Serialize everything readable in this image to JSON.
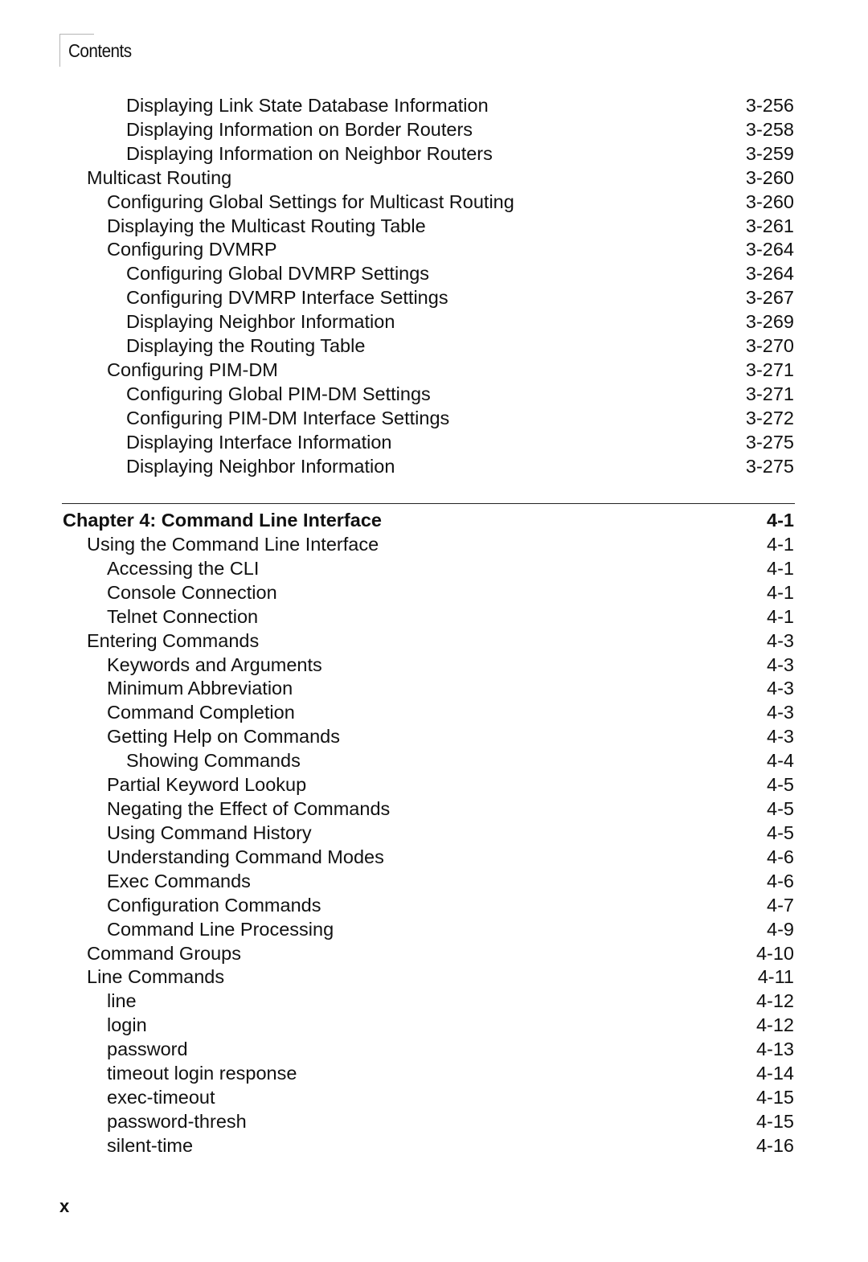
{
  "header": {
    "title": "Contents"
  },
  "toc_part1": [
    {
      "level": 3,
      "title": "Displaying Link State Database Information",
      "page": "3-256"
    },
    {
      "level": 3,
      "title": "Displaying Information on Border Routers",
      "page": "3-258"
    },
    {
      "level": 3,
      "title": "Displaying Information on Neighbor Routers",
      "page": "3-259"
    },
    {
      "level": 1,
      "title": "Multicast Routing",
      "page": "3-260"
    },
    {
      "level": 2,
      "title": "Configuring Global Settings for Multicast Routing",
      "page": "3-260"
    },
    {
      "level": 2,
      "title": "Displaying the Multicast Routing Table",
      "page": "3-261"
    },
    {
      "level": 2,
      "title": "Configuring DVMRP",
      "page": "3-264"
    },
    {
      "level": 3,
      "title": "Configuring Global DVMRP Settings",
      "page": "3-264"
    },
    {
      "level": 3,
      "title": "Configuring DVMRP Interface Settings",
      "page": "3-267"
    },
    {
      "level": 3,
      "title": "Displaying Neighbor Information",
      "page": "3-269"
    },
    {
      "level": 3,
      "title": "Displaying the Routing Table",
      "page": "3-270"
    },
    {
      "level": 2,
      "title": "Configuring PIM-DM",
      "page": "3-271"
    },
    {
      "level": 3,
      "title": "Configuring Global PIM-DM Settings",
      "page": "3-271"
    },
    {
      "level": 3,
      "title": "Configuring PIM-DM Interface Settings",
      "page": "3-272"
    },
    {
      "level": 3,
      "title": "Displaying Interface Information",
      "page": "3-275"
    },
    {
      "level": 3,
      "title": "Displaying Neighbor Information",
      "page": "3-275"
    }
  ],
  "toc_part2": [
    {
      "level": 0,
      "title": "Chapter 4: Command Line Interface",
      "page": "4-1"
    },
    {
      "level": 1,
      "title": "Using the Command Line Interface",
      "page": "4-1"
    },
    {
      "level": 2,
      "title": "Accessing the CLI",
      "page": "4-1"
    },
    {
      "level": 2,
      "title": "Console Connection",
      "page": "4-1"
    },
    {
      "level": 2,
      "title": "Telnet Connection",
      "page": "4-1"
    },
    {
      "level": 1,
      "title": "Entering Commands",
      "page": "4-3"
    },
    {
      "level": 2,
      "title": "Keywords and Arguments",
      "page": "4-3"
    },
    {
      "level": 2,
      "title": "Minimum Abbreviation",
      "page": "4-3"
    },
    {
      "level": 2,
      "title": "Command Completion",
      "page": "4-3"
    },
    {
      "level": 2,
      "title": "Getting Help on Commands",
      "page": "4-3"
    },
    {
      "level": 3,
      "title": "Showing Commands",
      "page": "4-4"
    },
    {
      "level": 2,
      "title": "Partial Keyword Lookup",
      "page": "4-5"
    },
    {
      "level": 2,
      "title": "Negating the Effect of Commands",
      "page": "4-5"
    },
    {
      "level": 2,
      "title": "Using Command History",
      "page": "4-5"
    },
    {
      "level": 2,
      "title": "Understanding Command Modes",
      "page": "4-6"
    },
    {
      "level": 2,
      "title": "Exec Commands",
      "page": "4-6"
    },
    {
      "level": 2,
      "title": "Configuration Commands",
      "page": "4-7"
    },
    {
      "level": 2,
      "title": "Command Line Processing",
      "page": "4-9"
    },
    {
      "level": 1,
      "title": "Command Groups",
      "page": "4-10"
    },
    {
      "level": 1,
      "title": "Line Commands",
      "page": "4-11"
    },
    {
      "level": 2,
      "title": "line",
      "page": "4-12"
    },
    {
      "level": 2,
      "title": "login",
      "page": "4-12"
    },
    {
      "level": 2,
      "title": "password",
      "page": "4-13"
    },
    {
      "level": 2,
      "title": "timeout login response",
      "page": "4-14"
    },
    {
      "level": 2,
      "title": "exec-timeout",
      "page": "4-15"
    },
    {
      "level": 2,
      "title": "password-thresh",
      "page": "4-15"
    },
    {
      "level": 2,
      "title": "silent-time",
      "page": "4-16"
    }
  ],
  "footer": {
    "page_number": "x"
  }
}
